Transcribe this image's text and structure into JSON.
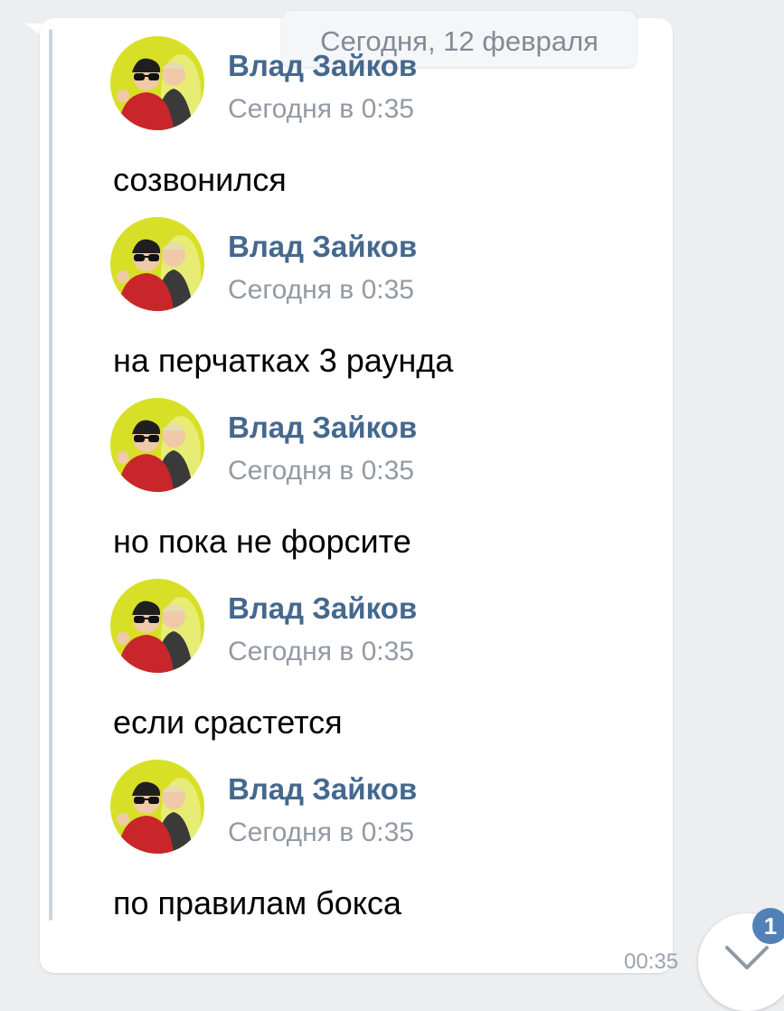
{
  "date_divider": "Сегодня, 12 февраля",
  "messages": [
    {
      "author": "Влад Зайков",
      "time": "Сегодня в 0:35",
      "text": "созвонился"
    },
    {
      "author": "Влад Зайков",
      "time": "Сегодня в 0:35",
      "text": "на перчатках 3 раунда"
    },
    {
      "author": "Влад Зайков",
      "time": "Сегодня в 0:35",
      "text": "но пока не форсите"
    },
    {
      "author": "Влад Зайков",
      "time": "Сегодня в 0:35",
      "text": "если срастется"
    },
    {
      "author": "Влад Зайков",
      "time": "Сегодня в 0:35",
      "text": "по правилам бокса"
    }
  ],
  "bubble_time": "00:35",
  "unread_badge": "1",
  "colors": {
    "background": "#edeef0",
    "bubble": "#ffffff",
    "author": "#45688e",
    "timestamp": "#939aa3",
    "forward_line": "#c9d4df",
    "badge": "#5181b8",
    "avatar_bg": "#d7e026"
  }
}
